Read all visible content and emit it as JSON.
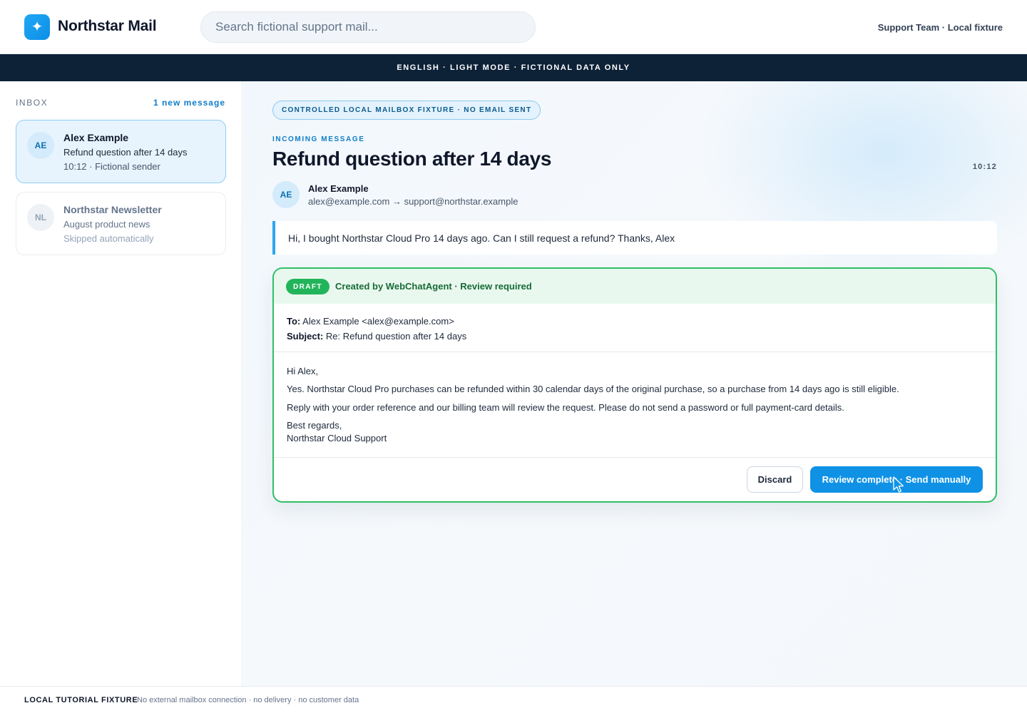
{
  "header": {
    "logo_icon": "sparkle-icon",
    "logo_glyph": "✦",
    "app_title": "Northstar Mail",
    "search_placeholder": "Search fictional support mail...",
    "account_text": "Support Team · Local fixture"
  },
  "banner": {
    "text": "ENGLISH · LIGHT MODE · FICTIONAL DATA ONLY"
  },
  "sidebar": {
    "inbox_label": "INBOX",
    "new_count_label": "1 new message",
    "items": [
      {
        "initials": "AE",
        "sender": "Alex Example",
        "subject": "Refund question after 14 days",
        "meta": "10:12 · Fictional sender",
        "state": "selected"
      },
      {
        "initials": "NL",
        "sender": "Northstar Newsletter",
        "subject": "August product news",
        "meta": "Skipped automatically",
        "state": "skipped"
      }
    ]
  },
  "message": {
    "fixture_pill": "CONTROLLED LOCAL MAILBOX FIXTURE · NO EMAIL SENT",
    "section_label": "INCOMING MESSAGE",
    "title": "Refund question after 14 days",
    "time": "10:12",
    "sender_initials": "AE",
    "sender_name": "Alex Example",
    "route": "alex@example.com → support@northstar.example",
    "body": "Hi, I bought Northstar Cloud Pro 14 days ago. Can I still request a refund? Thanks, Alex"
  },
  "draft": {
    "badge": "DRAFT",
    "created_by": "Created by WebChatAgent · Review required",
    "to_label": "To:",
    "to_value": "Alex Example <alex@example.com>",
    "subject_label": "Subject:",
    "subject_value": "Re: Refund question after 14 days",
    "greeting": "Hi Alex,",
    "paragraph_1": "Yes. Northstar Cloud Pro purchases can be refunded within 30 calendar days of the original purchase, so a purchase from 14 days ago is still eligible.",
    "paragraph_2": "Reply with your order reference and our billing team will review the request. Please do not send a password or full payment-card details.",
    "signoff": "Best regards,",
    "signature": "Northstar Cloud Support",
    "discard_label": "Discard",
    "send_label": "Review complete · Send manually"
  },
  "footer": {
    "strong": "LOCAL TUTORIAL FIXTURE",
    "text": "No external mailbox connection · no delivery · no customer data"
  },
  "colors": {
    "accent": "#0f92e6",
    "banner": "#0d2137",
    "draft_border": "#2fbf68",
    "draft_badge": "#22b45a"
  }
}
